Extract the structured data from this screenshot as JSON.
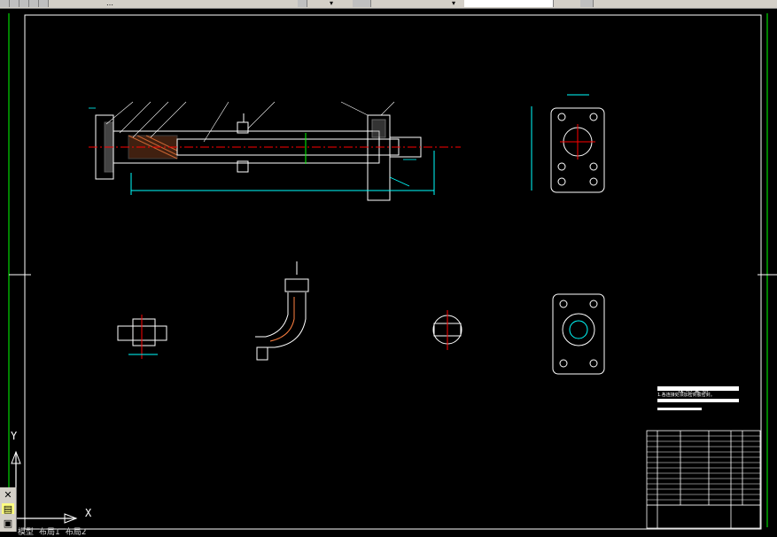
{
  "app": {
    "menu_fragments": [
      "…",
      "▾",
      "▾"
    ],
    "colors": {
      "background": "#000000",
      "frame": "#ffffff",
      "border_green": "#00ff00",
      "dim_cyan": "#00ffff",
      "red_center": "#ff0000",
      "yellow": "#ffff00"
    }
  },
  "ucs": {
    "y_label": "Y",
    "x_label": "X"
  },
  "drawing_tabs": [
    "模型",
    "布局1",
    "布局2"
  ],
  "title_block": {
    "tech_heading": "技 术 要 求",
    "tech_line1": "1.各连接处须加密封胶密封。"
  },
  "left_tools": [
    {
      "name": "close-icon",
      "glyph": "✕"
    },
    {
      "name": "layers-icon",
      "glyph": "▤"
    },
    {
      "name": "properties-icon",
      "glyph": "▣"
    }
  ]
}
